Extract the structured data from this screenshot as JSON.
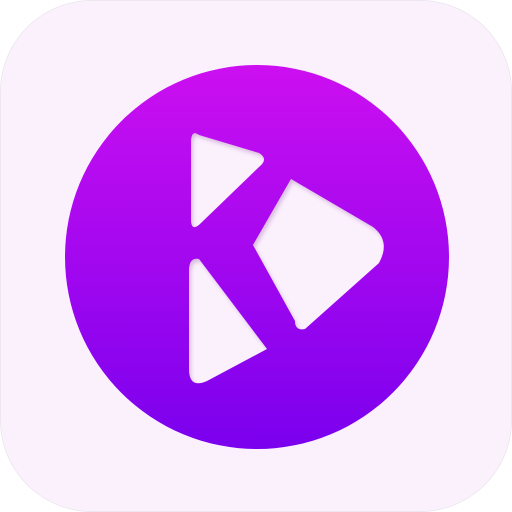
{
  "app_icon": {
    "icon": "play-logo-k-icon",
    "colors": {
      "tile_background": "#fbf1fd",
      "circle_top": "#cc0ff0",
      "circle_bottom": "#7a00ee",
      "glyph_fill": "#fbf1fd"
    }
  }
}
